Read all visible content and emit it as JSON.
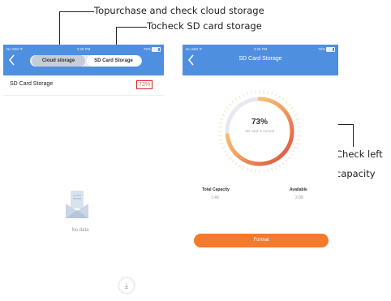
{
  "annotations": {
    "cloud": "Topurchase and check cloud storage",
    "sd": "Tocheck SD card storage",
    "check_left_line1": "Check left",
    "check_left_line2": "capacity"
  },
  "left_screen": {
    "status": {
      "carrier": "No SIM ᯤ",
      "time": "3:26 PM",
      "battery": "75%"
    },
    "tabs": [
      "Cloud storage",
      "SD Card Storage"
    ],
    "active_tab": "SD Card Storage",
    "row": {
      "label": "SD Card Storage",
      "value": "73%"
    },
    "empty_text": "No data",
    "fab_icon": "download-icon"
  },
  "right_screen": {
    "status": {
      "carrier": "No SIM ᯤ",
      "time": "3:26 PM",
      "battery": "75%"
    },
    "title": "SD Card Storage",
    "gauge": {
      "value_text": "73%",
      "fraction": 0.73,
      "sub": "SD card is normal"
    },
    "capacity": {
      "total_label": "Total Capacity",
      "total_value": "7.49",
      "available_label": "Available",
      "available_value": "2.09"
    },
    "button": "Format"
  },
  "colors": {
    "accent": "#4f8fe0",
    "format": "#f47a2c",
    "highlight": "#e02020"
  }
}
